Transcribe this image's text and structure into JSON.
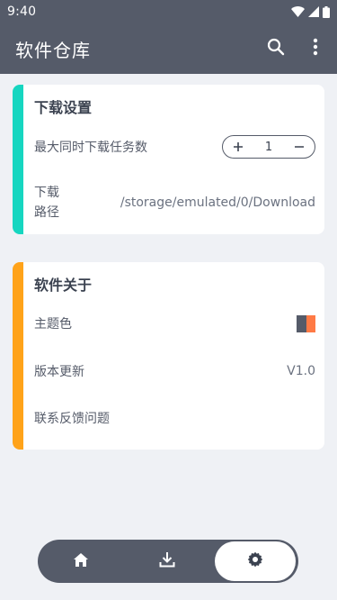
{
  "status_bar": {
    "time": "9:40"
  },
  "app_bar": {
    "title": "软件仓库"
  },
  "download_settings": {
    "title": "下载设置",
    "accent_color": "#16d6c0",
    "max_tasks_label": "最大同时下载任务数",
    "max_tasks_value": "1",
    "path_label": "下载路径",
    "path_value": "/storage/emulated/0/Download"
  },
  "about": {
    "title": "软件关于",
    "accent_color": "#ffa31a",
    "theme_label": "主题色",
    "theme_colors": [
      "#555b69",
      "#ff7a45"
    ],
    "version_label": "版本更新",
    "version_value": "V1.0",
    "feedback_label": "联系反馈问题"
  },
  "bottom_nav": {
    "items": [
      {
        "icon": "home-icon",
        "active": false
      },
      {
        "icon": "download-icon",
        "active": false
      },
      {
        "icon": "settings-icon",
        "active": true
      }
    ]
  }
}
